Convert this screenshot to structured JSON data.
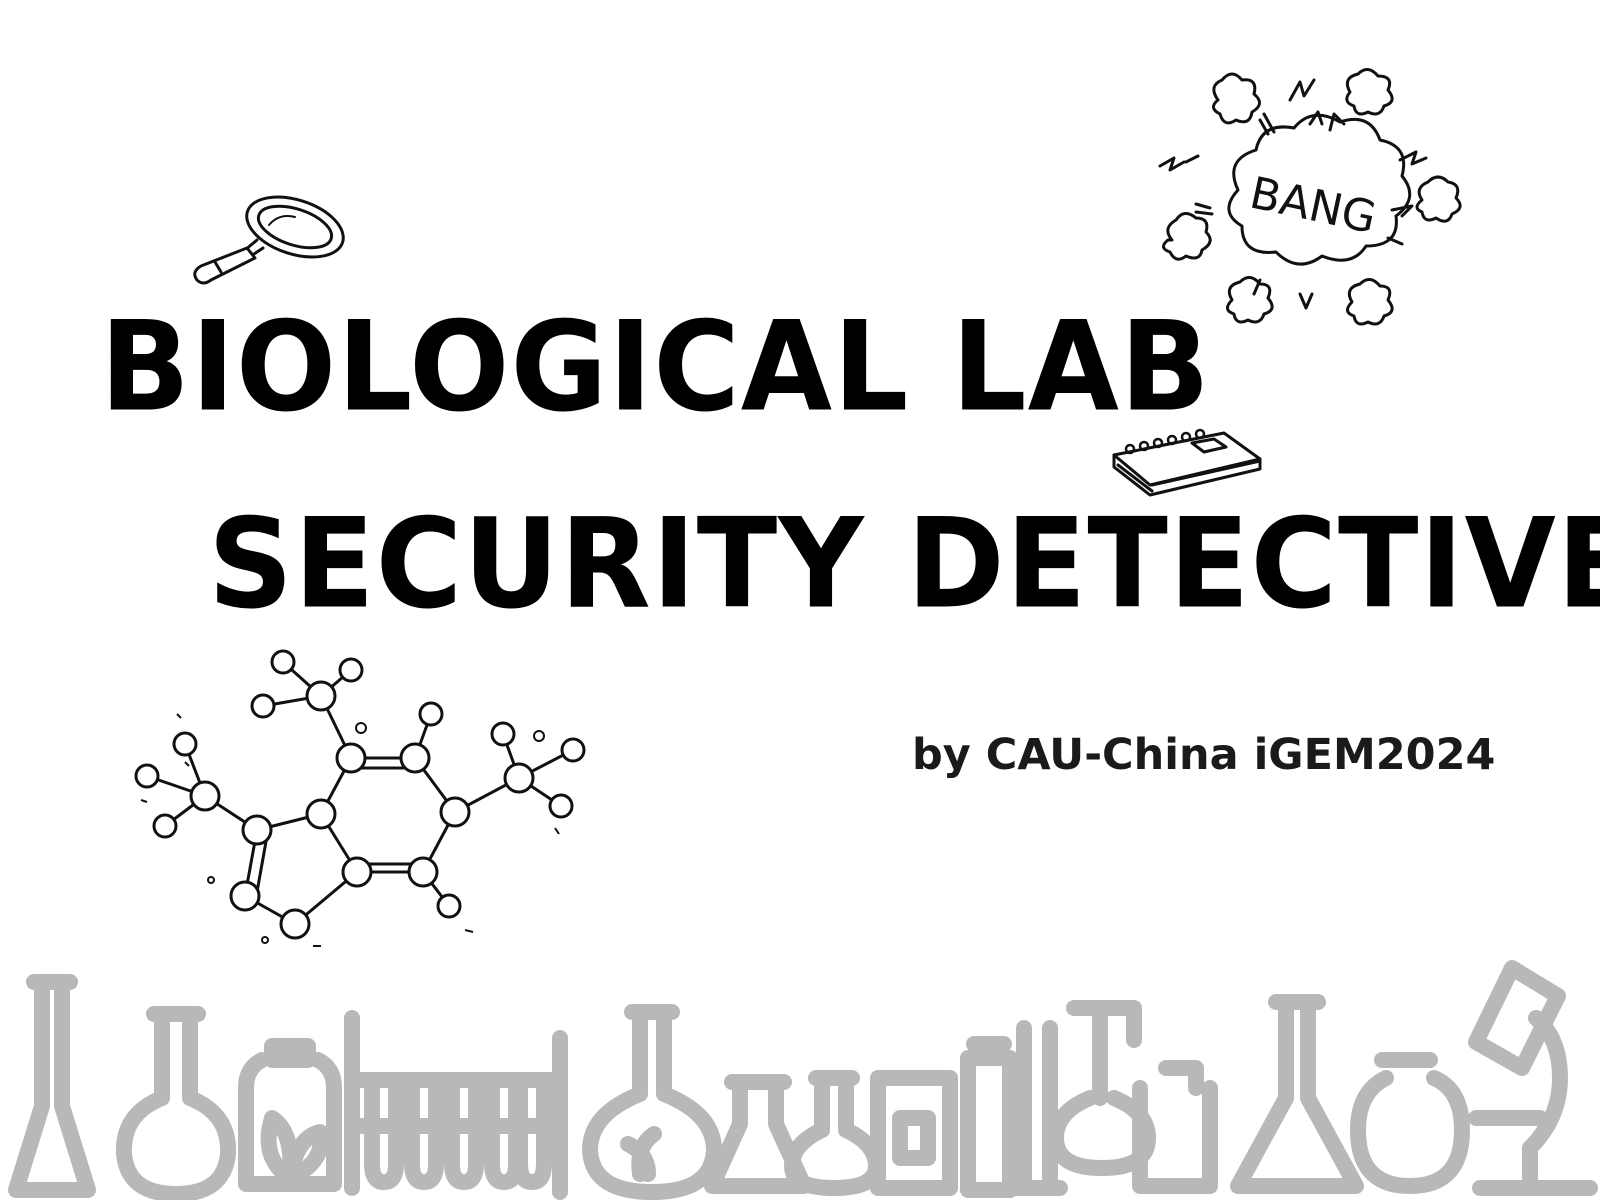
{
  "title": {
    "line1": "BIOLOGICAL LAB",
    "line2": "SECURITY DETECTIVE"
  },
  "subtitle": "by CAU-China iGEM2024",
  "bang_bubble": {
    "text": "BANG"
  },
  "icons": {
    "magnifier": "magnifying-glass-icon",
    "notebook": "spiral-notebook-icon",
    "explosion": "bang-explosion-icon",
    "molecule": "molecule-structure-icon",
    "glassware": "lab-glassware-row-icon"
  },
  "colors": {
    "text": "#000000",
    "subtitle": "#1a1a1a",
    "sketch": "#111111",
    "glassware": "#b8b8b8",
    "background": "#ffffff"
  }
}
